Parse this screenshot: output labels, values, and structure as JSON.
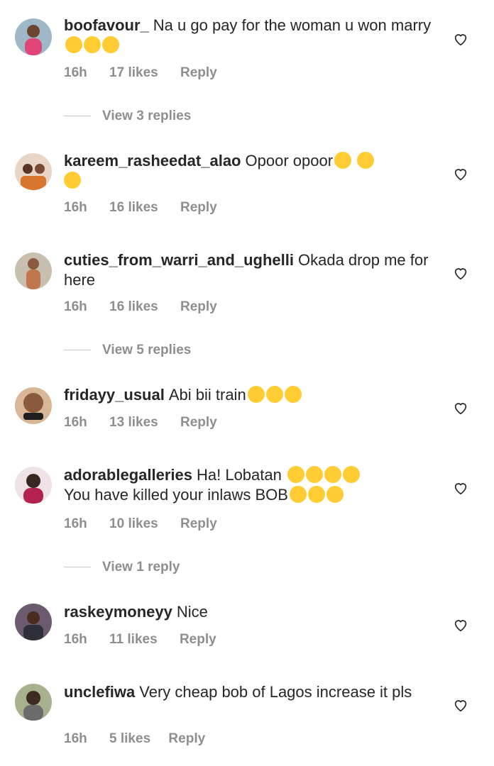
{
  "comments": [
    {
      "user": "boofavour_",
      "text": "Na u go pay for the woman u won marry",
      "emojis": 3,
      "emoji_type": "tears-of-joy",
      "time": "16h",
      "likes": "17 likes",
      "reply": "Reply",
      "view_replies": "View 3 replies",
      "avatar_color": "#c9567a"
    },
    {
      "user": "kareem_rasheedat_alao",
      "text": "Opoor opoor",
      "emojis": 3,
      "emoji_type": "heart-eyes",
      "time": "16h",
      "likes": "16 likes",
      "reply": "Reply",
      "view_replies": "",
      "avatar_color": "#d99a73"
    },
    {
      "user": "cuties_from_warri_and_ughelli",
      "text": "Okada drop me for here",
      "emojis": 0,
      "emoji_type": "",
      "time": "16h",
      "likes": "16 likes",
      "reply": "Reply",
      "view_replies": "View 5 replies",
      "avatar_color": "#c4876a"
    },
    {
      "user": "fridayy_usual",
      "text": "Abi bii train",
      "emojis": 3,
      "emoji_type": "tears-of-joy",
      "time": "16h",
      "likes": "13 likes",
      "reply": "Reply",
      "view_replies": "",
      "avatar_color": "#c89c79"
    },
    {
      "user": "adorablegalleries",
      "text": "Ha! Lobatan",
      "text2": "You have killed your inlaws BOB",
      "emojis": 4,
      "emojis2": 3,
      "emoji_type": "tears-of-joy",
      "time": "16h",
      "likes": "10 likes",
      "reply": "Reply",
      "view_replies": "View 1 reply",
      "avatar_color": "#b53a59"
    },
    {
      "user": "raskeymoneyy",
      "text": "Nice",
      "emojis": 0,
      "emoji_type": "",
      "time": "16h",
      "likes": "11 likes",
      "reply": "Reply",
      "view_replies": "",
      "avatar_color": "#4a3c56"
    },
    {
      "user": "unclefiwa",
      "text": "Very cheap bob of Lagos increase it pls",
      "emojis": 0,
      "emoji_type": "",
      "time": "16h",
      "likes": "5 likes",
      "reply": "Reply",
      "view_replies": "",
      "avatar_color": "#7b8a5c"
    }
  ],
  "icons": {
    "like": "heart-outline-icon"
  },
  "colors": {
    "text": "#262626",
    "meta": "#8e8e8e",
    "emoji": "#FFCC33"
  }
}
